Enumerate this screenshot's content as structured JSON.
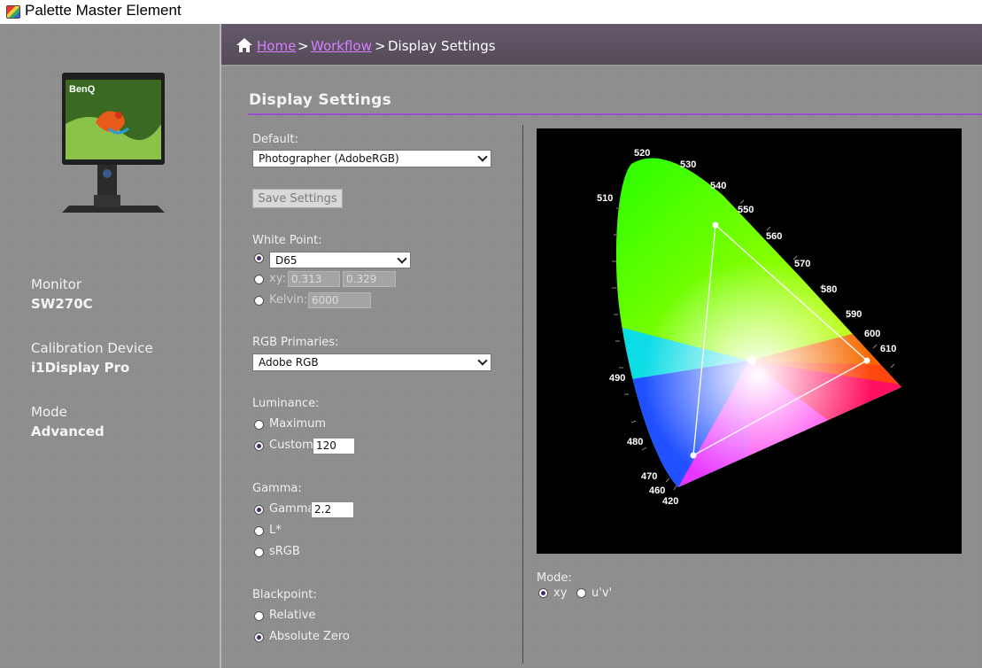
{
  "app": {
    "title": "Palette Master Element"
  },
  "sidebar": {
    "monitor_brand": "BenQ",
    "monitor_label": "Monitor",
    "monitor_value": "SW270C",
    "device_label": "Calibration Device",
    "device_value": "i1Display Pro",
    "mode_label": "Mode",
    "mode_value": "Advanced"
  },
  "breadcrumb": {
    "home": "Home",
    "sep1": ">",
    "workflow": "Workflow",
    "sep2": ">",
    "current": "Display Settings"
  },
  "page": {
    "title": "Display Settings"
  },
  "form": {
    "default_label": "Default:",
    "default_value": "Photographer (AdobeRGB)",
    "save_label": "Save Settings",
    "whitepoint_label": "White Point:",
    "whitepoint_preset": "D65",
    "xy_label": "xy:",
    "x_value": "0.313",
    "y_value": "0.329",
    "kelvin_label": "Kelvin:",
    "kelvin_value": "6000",
    "primaries_label": "RGB Primaries:",
    "primaries_value": "Adobe RGB",
    "luminance_label": "Luminance:",
    "lum_max": "Maximum",
    "lum_custom": "Custom",
    "lum_value": "120",
    "gamma_label": "Gamma:",
    "gamma_opt": "Gamma",
    "gamma_value": "2.2",
    "gamma_lstar": "L*",
    "gamma_srgb": "sRGB",
    "blackpoint_label": "Blackpoint:",
    "bp_relative": "Relative",
    "bp_absolute": "Absolute Zero"
  },
  "diagram": {
    "wavelength_labels": [
      "520",
      "530",
      "540",
      "550",
      "560",
      "570",
      "580",
      "590",
      "600",
      "610",
      "510",
      "490",
      "480",
      "470",
      "460",
      "420"
    ]
  },
  "mode": {
    "label": "Mode:",
    "xy": "xy",
    "uv": "u'v'"
  },
  "colors": {
    "accent": "#9b4fcf",
    "link": "#d77fff",
    "header": "#5a5060"
  }
}
